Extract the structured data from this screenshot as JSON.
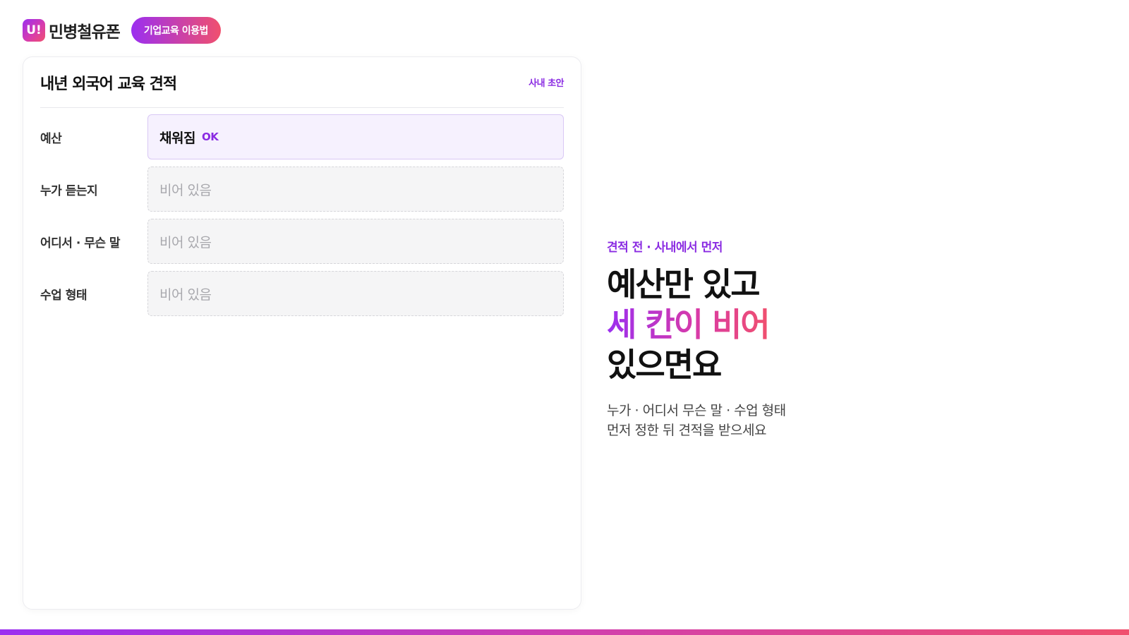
{
  "header": {
    "logo_mark": "U!",
    "brand": "민병철유폰",
    "guide_button": "기업교육 이용법"
  },
  "card": {
    "title": "내년 외국어 교육 견적",
    "tag": "사내 초안",
    "rows": [
      {
        "label": "예산",
        "value": "채워짐",
        "badge": "OK"
      },
      {
        "label": "누가 듣는지",
        "value": "비어 있음"
      },
      {
        "label": "어디서 · 무슨 말",
        "value": "비어 있음"
      },
      {
        "label": "수업 형태",
        "value": "비어 있음"
      }
    ]
  },
  "hero": {
    "eyebrow": "견적 전 · 사내에서 먼저",
    "line1": "예산만 있고",
    "line2": "세 칸이 비어",
    "line3": "있으면요",
    "sub1": "누가 · 어디서 무슨 말 · 수업 형태",
    "sub2": "먼저 정한 뒤 견적을 받으세요"
  },
  "colors": {
    "accent_purple": "#8a2be2",
    "gradient_start": "#9b2ff0",
    "gradient_end": "#f0506e"
  }
}
